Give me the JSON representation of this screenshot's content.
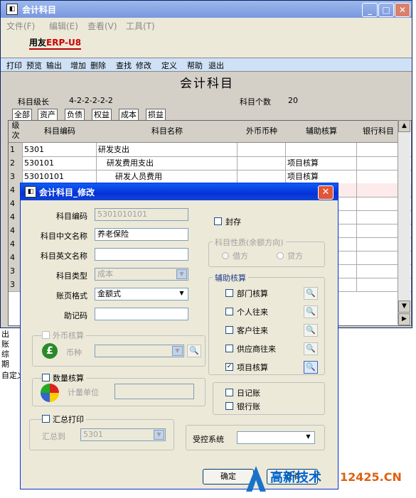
{
  "main_window": {
    "title": "会计科目",
    "menu": [
      "文件(F)",
      "编辑(E)",
      "查看(V)",
      "工具(T)"
    ],
    "brand": {
      "prefix": "用友",
      "name": "ERP-",
      "suffix": "U8"
    },
    "toolbar": [
      "打印",
      "预览",
      "输出",
      "增加",
      "删除",
      "查找",
      "修改",
      "定义",
      "帮助",
      "退出"
    ],
    "heading": "会计科目",
    "level_label": "科目级长",
    "level_value": "4-2-2-2-2-2",
    "count_label": "科目个数",
    "count_value": "20",
    "tabs": [
      "全部",
      "资产",
      "负债",
      "权益",
      "成本",
      "损益"
    ],
    "columns": [
      "级次",
      "科目编码",
      "科目名称",
      "外币币种",
      "辅助核算",
      "银行科目"
    ],
    "rows": [
      {
        "level": "1",
        "code": "5301",
        "name": "研发支出",
        "currency": "",
        "aux": ""
      },
      {
        "level": "2",
        "code": "530101",
        "name": "研发费用支出",
        "currency": "",
        "aux": "项目核算"
      },
      {
        "level": "3",
        "code": "53010101",
        "name": "研发人员费用",
        "currency": "",
        "aux": "项目核算"
      },
      {
        "level": "4",
        "code": "",
        "name": "",
        "currency": "",
        "aux": ""
      },
      {
        "level": "4",
        "code": "",
        "name": "",
        "currency": "",
        "aux": ""
      },
      {
        "level": "4",
        "code": "",
        "name": "",
        "currency": "",
        "aux": ""
      },
      {
        "level": "4",
        "code": "",
        "name": "",
        "currency": "",
        "aux": ""
      },
      {
        "level": "4",
        "code": "",
        "name": "",
        "currency": "",
        "aux": ""
      },
      {
        "level": "4",
        "code": "",
        "name": "",
        "currency": "",
        "aux": ""
      },
      {
        "level": "3",
        "code": "",
        "name": "",
        "currency": "",
        "aux": ""
      },
      {
        "level": "3",
        "code": "",
        "name": "",
        "currency": "",
        "aux": ""
      }
    ],
    "leftover": [
      "出",
      "账",
      "综",
      "期",
      "自定义"
    ]
  },
  "dialog": {
    "title": "会计科目_修改",
    "fields": {
      "code_label": "科目编码",
      "code_value": "5301010101",
      "cn_name_label": "科目中文名称",
      "cn_name_value": "养老保险",
      "en_name_label": "科目英文名称",
      "en_name_value": "",
      "type_label": "科目类型",
      "type_value": "成本",
      "format_label": "账页格式",
      "format_value": "金额式",
      "mnemonic_label": "助记码",
      "mnemonic_value": ""
    },
    "sealed_label": "封存",
    "nature_group": "科目性质(余额方向)",
    "debit_label": "借方",
    "credit_label": "贷方",
    "aux_group": "辅助核算",
    "aux_items": [
      {
        "label": "部门核算",
        "checked": false
      },
      {
        "label": "个人往来",
        "checked": false
      },
      {
        "label": "客户往来",
        "checked": false
      },
      {
        "label": "供应商往来",
        "checked": false
      },
      {
        "label": "项目核算",
        "checked": true
      }
    ],
    "journal_label": "日记账",
    "bank_label": "银行账",
    "forex_group": "外币核算",
    "currency_label": "币种",
    "qty_group": "数量核算",
    "unit_label": "计量单位",
    "summary_group": "汇总打印",
    "summary_to_label": "汇总到",
    "summary_to_value": "5301",
    "controlled_label": "受控系统",
    "controlled_value": "",
    "ok_label": "确定",
    "cancel_label": "取消"
  },
  "watermark": {
    "text": "高新技术",
    "domain": "12425.CN"
  }
}
